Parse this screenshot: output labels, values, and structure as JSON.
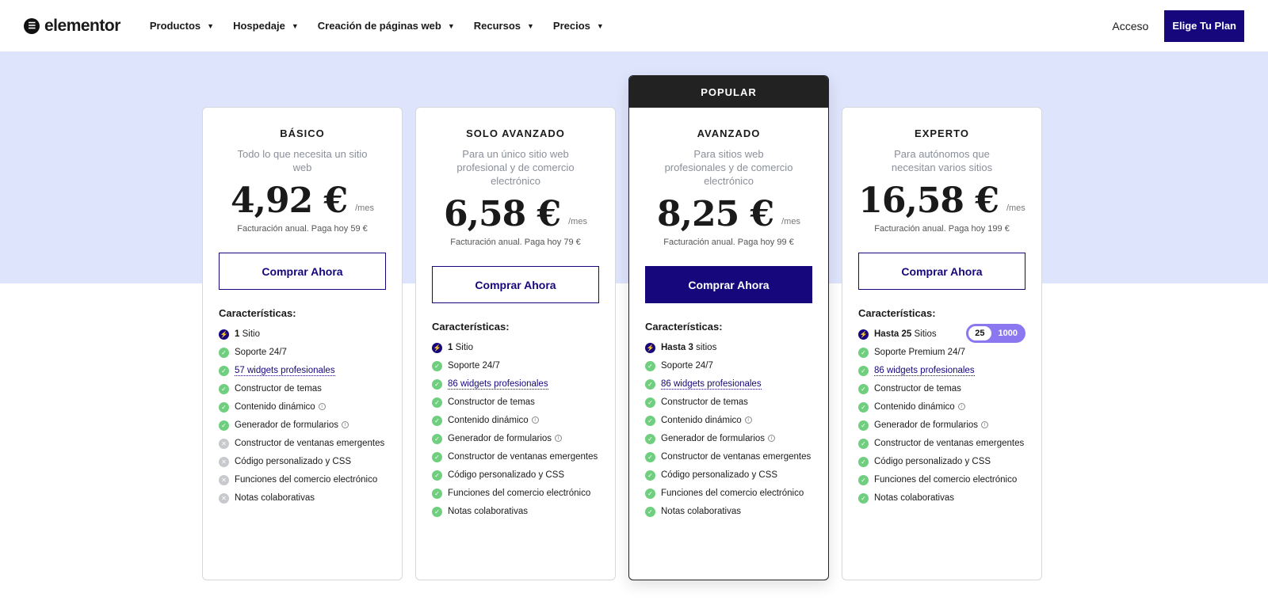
{
  "nav": {
    "logo": "elementor",
    "menu": [
      "Productos",
      "Hospedaje",
      "Creación de páginas web",
      "Recursos",
      "Precios"
    ],
    "login": "Acceso",
    "cta": "Elige Tu Plan"
  },
  "colors": {
    "brand": "#16077c",
    "band": "#dfe4fd",
    "check": "#6fcf7f"
  },
  "features_title": "Características:",
  "popular_label": "POPULAR",
  "plans": [
    {
      "name": "BÁSICO",
      "desc": "Todo lo que necesita un sitio web",
      "price": "4,92 €",
      "per": "/mes",
      "billing": "Facturación anual. Paga hoy 59 €",
      "button": "Comprar Ahora",
      "popular": false,
      "features": [
        {
          "icon": "bolt",
          "bold": "1",
          "text": "Sitio"
        },
        {
          "icon": "check",
          "text": "Soporte 24/7"
        },
        {
          "icon": "check",
          "text": "57 widgets profesionales",
          "link": true
        },
        {
          "icon": "check",
          "text": "Constructor de temas"
        },
        {
          "icon": "check",
          "text": "Contenido dinámico",
          "info": true
        },
        {
          "icon": "check",
          "text": "Generador de formularios",
          "info": true
        },
        {
          "icon": "cross",
          "text": "Constructor de ventanas emergentes"
        },
        {
          "icon": "cross",
          "text": "Código personalizado y CSS"
        },
        {
          "icon": "cross",
          "text": "Funciones del comercio electrónico"
        },
        {
          "icon": "cross",
          "text": "Notas colaborativas"
        }
      ]
    },
    {
      "name": "SOLO AVANZADO",
      "desc": "Para un único sitio web profesional y de comercio electrónico",
      "price": "6,58 €",
      "per": "/mes",
      "billing": "Facturación anual. Paga hoy 79 €",
      "button": "Comprar Ahora",
      "popular": false,
      "features": [
        {
          "icon": "bolt",
          "bold": "1",
          "text": "Sitio"
        },
        {
          "icon": "check",
          "text": "Soporte 24/7"
        },
        {
          "icon": "check",
          "text": "86 widgets profesionales",
          "link": true
        },
        {
          "icon": "check",
          "text": "Constructor de temas"
        },
        {
          "icon": "check",
          "text": "Contenido dinámico",
          "info": true
        },
        {
          "icon": "check",
          "text": "Generador de formularios",
          "info": true
        },
        {
          "icon": "check",
          "text": "Constructor de ventanas emergentes"
        },
        {
          "icon": "check",
          "text": "Código personalizado y CSS"
        },
        {
          "icon": "check",
          "text": "Funciones del comercio electrónico"
        },
        {
          "icon": "check",
          "text": "Notas colaborativas"
        }
      ]
    },
    {
      "name": "AVANZADO",
      "desc": "Para sitios web profesionales y de comercio electrónico",
      "price": "8,25 €",
      "per": "/mes",
      "billing": "Facturación anual. Paga hoy 99 €",
      "button": "Comprar Ahora",
      "popular": true,
      "features": [
        {
          "icon": "bolt",
          "bold": "Hasta 3",
          "text": "sitios"
        },
        {
          "icon": "check",
          "text": "Soporte 24/7"
        },
        {
          "icon": "check",
          "text": "86 widgets profesionales",
          "link": true
        },
        {
          "icon": "check",
          "text": "Constructor de temas"
        },
        {
          "icon": "check",
          "text": "Contenido dinámico",
          "info": true
        },
        {
          "icon": "check",
          "text": "Generador de formularios",
          "info": true
        },
        {
          "icon": "check",
          "text": "Constructor de ventanas emergentes"
        },
        {
          "icon": "check",
          "text": "Código personalizado y CSS"
        },
        {
          "icon": "check",
          "text": "Funciones del comercio electrónico"
        },
        {
          "icon": "check",
          "text": "Notas colaborativas"
        }
      ]
    },
    {
      "name": "EXPERTO",
      "desc": "Para autónomos que necesitan varios sitios",
      "price": "16,58 €",
      "per": "/mes",
      "billing": "Facturación anual. Paga hoy 199 €",
      "button": "Comprar Ahora",
      "popular": false,
      "toggle": [
        "25",
        "1000"
      ],
      "features": [
        {
          "icon": "bolt",
          "bold": "Hasta 25",
          "text": "Sitios"
        },
        {
          "icon": "check",
          "text": "Soporte Premium 24/7"
        },
        {
          "icon": "check",
          "text": "86 widgets profesionales",
          "link": true
        },
        {
          "icon": "check",
          "text": "Constructor de temas"
        },
        {
          "icon": "check",
          "text": "Contenido dinámico",
          "info": true
        },
        {
          "icon": "check",
          "text": "Generador de formularios",
          "info": true
        },
        {
          "icon": "check",
          "text": "Constructor de ventanas emergentes"
        },
        {
          "icon": "check",
          "text": "Código personalizado y CSS"
        },
        {
          "icon": "check",
          "text": "Funciones del comercio electrónico"
        },
        {
          "icon": "check",
          "text": "Notas colaborativas"
        }
      ]
    }
  ]
}
